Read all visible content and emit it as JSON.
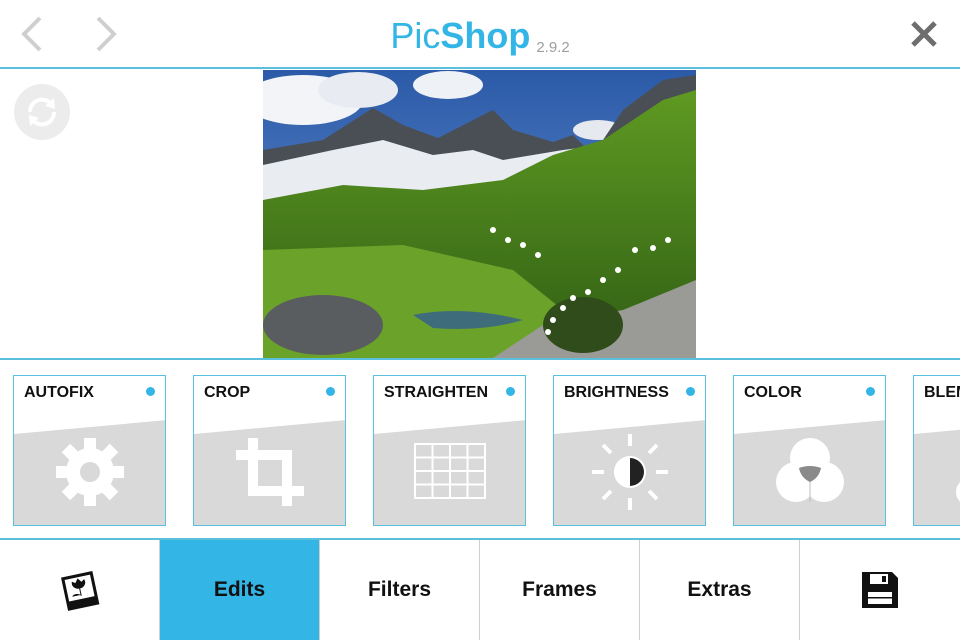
{
  "header": {
    "title_light": "Pic",
    "title_bold": "Shop",
    "version": "2.9.2",
    "back_icon": "chevron-left-icon",
    "forward_icon": "chevron-right-icon",
    "close_icon": "close-icon"
  },
  "main": {
    "rotate_icon": "rotate-icon",
    "photo_description_hidden": ""
  },
  "tools": [
    {
      "label": "AUTOFIX",
      "icon": "gear-icon"
    },
    {
      "label": "CROP",
      "icon": "crop-icon"
    },
    {
      "label": "STRAIGHTEN",
      "icon": "grid-icon"
    },
    {
      "label": "BRIGHTNESS",
      "icon": "sun-icon"
    },
    {
      "label": "COLOR",
      "icon": "color-circles-icon"
    },
    {
      "label": "BLEMISH",
      "icon": "blemish-icon"
    }
  ],
  "tabs": [
    {
      "label": "",
      "icon": "gallery-icon"
    },
    {
      "label": "Edits",
      "active": true
    },
    {
      "label": "Filters"
    },
    {
      "label": "Frames"
    },
    {
      "label": "Extras"
    },
    {
      "label": "",
      "icon": "save-icon"
    }
  ],
  "colors": {
    "accent": "#33b5e5",
    "border": "#5bc0de",
    "tool_bg": "#d9d9d9"
  }
}
